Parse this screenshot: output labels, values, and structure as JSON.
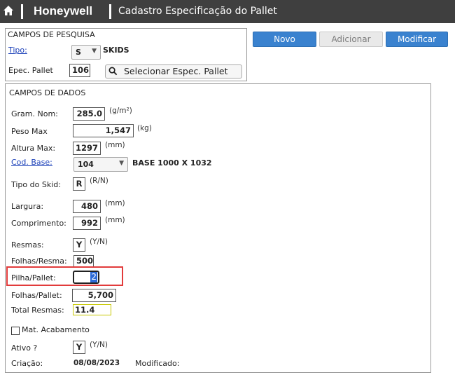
{
  "header": {
    "brand": "Honeywell",
    "title": "Cadastro Especificação do Pallet"
  },
  "toolbar": {
    "novo": "Novo",
    "adicionar": "Adicionar",
    "modificar": "Modificar"
  },
  "pesquisa": {
    "legend": "CAMPOS DE PESQUISA",
    "tipo_label": "Tipo:",
    "tipo_value": "S",
    "tipo_desc": "SKIDS",
    "espec_label": "Epec. Pallet",
    "espec_value": "106",
    "select_button": "Selecionar Espec. Pallet"
  },
  "dados": {
    "legend": "CAMPOS DE DADOS",
    "gram_label": "Gram. Nom:",
    "gram_value": "285.0",
    "gram_unit": "(g/m²)",
    "peso_label": "Peso Max",
    "peso_value": "1,547",
    "peso_unit": "(kg)",
    "altura_label": "Altura Max:",
    "altura_value": "1297",
    "altura_unit": "(mm)",
    "cod_label": "Cod. Base:",
    "cod_value": "104",
    "cod_desc": "BASE 1000 X 1032",
    "skid_label": "Tipo do Skid:",
    "skid_value": "R",
    "skid_unit": "(R/N)",
    "largura_label": "Largura:",
    "largura_value": "480",
    "largura_unit": "(mm)",
    "comp_label": "Comprimento:",
    "comp_value": "992",
    "comp_unit": "(mm)",
    "resmas_label": "Resmas:",
    "resmas_value": "Y",
    "resmas_unit": "(Y/N)",
    "folhas_resma_label": "Folhas/Resma:",
    "folhas_resma_value": "500",
    "pilha_label": "Pilha/Pallet:",
    "pilha_value": "2",
    "folhas_pallet_label": "Folhas/Pallet:",
    "folhas_pallet_value": "5,700",
    "total_label": "Total Resmas:",
    "total_value": "11.4",
    "mat_label": "Mat. Acabamento",
    "ativo_label": "Ativo ?",
    "ativo_value": "Y",
    "ativo_unit": "(Y/N)",
    "criacao_label": "Criação:",
    "criacao_value": "08/08/2023",
    "modificado_label": "Modificado:"
  },
  "colors": {
    "topbar": "#3f3f3f",
    "button_blue": "#3a82cf",
    "highlight": "#e23b3b",
    "total_border": "#c8c800"
  }
}
